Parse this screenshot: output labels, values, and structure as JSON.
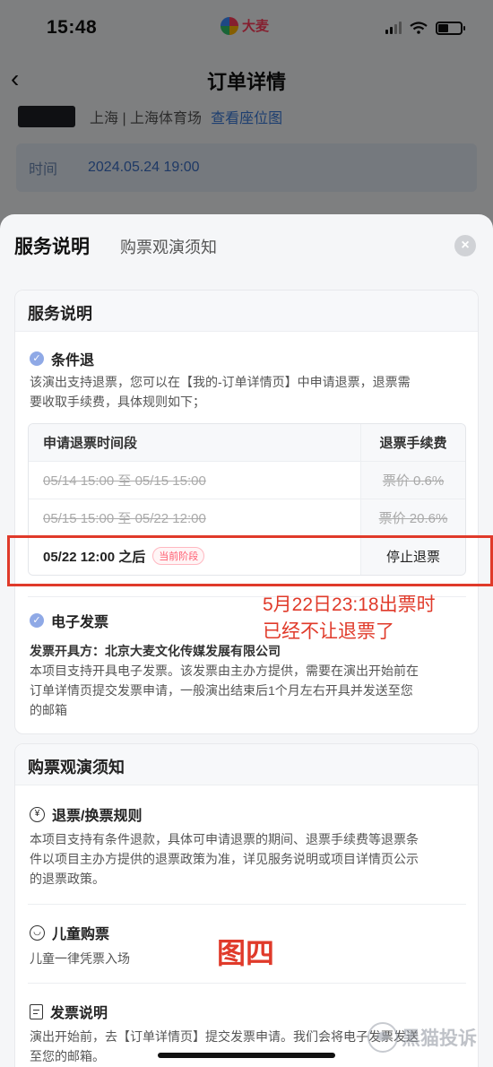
{
  "status_bar": {
    "time": "15:48",
    "brand": "大麦"
  },
  "nav": {
    "title": "订单详情"
  },
  "order": {
    "venue": "上海 | 上海体育场",
    "seat_link": "查看座位图",
    "time_label": "时间",
    "time_value": "2024.05.24 19:00"
  },
  "sheet": {
    "tabs": [
      "服务说明",
      "购票观演须知"
    ],
    "close_label": "×"
  },
  "service": {
    "title": "服务说明",
    "refund_title": "条件退",
    "refund_text_1": "该演出支持退票，您可以在【我的-订单详情页】中申请退票，退票需",
    "refund_text_2": "要收取手续费，具体规则如下；",
    "table_headers": [
      "申请退票时间段",
      "退票手续费"
    ],
    "table_rows": [
      {
        "period": "05/14 15:00 至 05/15 15:00",
        "fee": "票价 0.6%",
        "state": "past"
      },
      {
        "period": "05/15 15:00 至 05/22 12:00",
        "fee": "票价 20.6%",
        "state": "past"
      },
      {
        "period": "05/22 12:00 之后",
        "fee": "停止退票",
        "state": "current",
        "badge": "当前阶段"
      }
    ],
    "invoice_title": "电子发票",
    "invoice_issuer": "发票开具方：北京大麦文化传媒发展有限公司",
    "invoice_text_1": "本项目支持开具电子发票。该发票由主办方提供，需要在演出开始前在",
    "invoice_text_2": "订单详情页提交发票申请，一般演出结束后1个月左右开具并发送至您",
    "invoice_text_3": "的邮箱"
  },
  "annotation": {
    "line1": "5月22日23:18出票时",
    "line2": "已经不让退票了",
    "figure_label": "图四"
  },
  "notice": {
    "title": "购票观演须知",
    "rules_title": "退票/换票规则",
    "rules_text_1": "本项目支持有条件退款，具体可申请退票的期间、退票手续费等退票条",
    "rules_text_2": "件以项目主办方提供的退票政策为准，详见服务说明或项目详情页公示",
    "rules_text_3": "的退票政策。",
    "child_title": "儿童购票",
    "child_text": "儿童一律凭票入场",
    "invoice_title": "发票说明",
    "invoice_text_1": "演出开始前，去【订单详情页】提交发票申请。我们会将电子发票发送",
    "invoice_text_2": "至您的邮箱。"
  },
  "watermark": {
    "text": "黑猫投诉"
  },
  "icons": {
    "refund": "check-circle-icon",
    "invoice": "check-circle-icon",
    "rules": "yen-circle-icon",
    "child": "child-face-icon",
    "invoice_note": "document-icon"
  },
  "colors": {
    "accent_red": "#e03a2a",
    "link_blue": "#3a7ad6",
    "badge_pink": "#ff5a6e"
  }
}
